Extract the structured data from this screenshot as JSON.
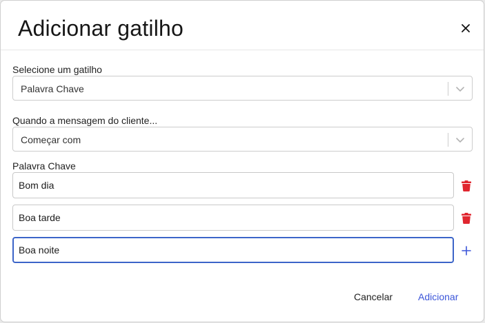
{
  "dialog": {
    "title": "Adicionar gatilho",
    "close_icon": "close-icon"
  },
  "trigger_select": {
    "label": "Selecione um gatilho",
    "value": "Palavra Chave",
    "icon": "chevron-down-icon"
  },
  "condition_select": {
    "label": "Quando a mensagem do cliente...",
    "value": "Começar com",
    "icon": "chevron-down-icon"
  },
  "keywords": {
    "label": "Palavra Chave",
    "items": [
      {
        "value": "Bom dia",
        "action_icon": "trash-icon"
      },
      {
        "value": "Boa tarde",
        "action_icon": "trash-icon"
      },
      {
        "value": "Boa noite",
        "action_icon": "plus-icon"
      }
    ]
  },
  "footer": {
    "cancel_label": "Cancelar",
    "add_label": "Adicionar"
  },
  "colors": {
    "accent": "#3b55d9",
    "focus_border": "#3b64c8",
    "delete_icon": "#e0262f"
  }
}
